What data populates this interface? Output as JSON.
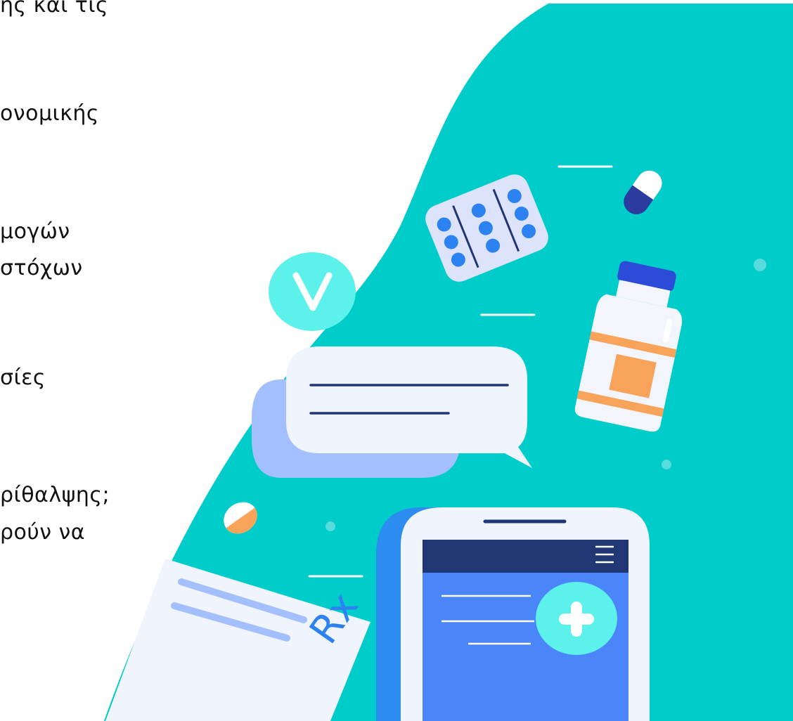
{
  "text_lines": [
    "ης και τις",
    "ονομικής",
    "μογών",
    "στόχων",
    "σίες",
    "ρίθαλψης;",
    "ρούν να"
  ],
  "prescription_symbol": "Rx",
  "icons": [
    "checkmark-badge-icon",
    "pill-blister-pack-icon",
    "capsule-icon",
    "medicine-bottle-icon",
    "chat-bubble-icon",
    "pill-icon",
    "prescription-paper-icon",
    "smartphone-icon",
    "hamburger-menu-icon",
    "plus-badge-icon"
  ],
  "colors": {
    "teal_background": "#00CCCA",
    "phone_blue": "#4A86FA",
    "phone_header": "#213775",
    "dark_blue": "#2B3C9E",
    "light_cyan": "#5CF1EA",
    "orange": "#F7A35A"
  }
}
